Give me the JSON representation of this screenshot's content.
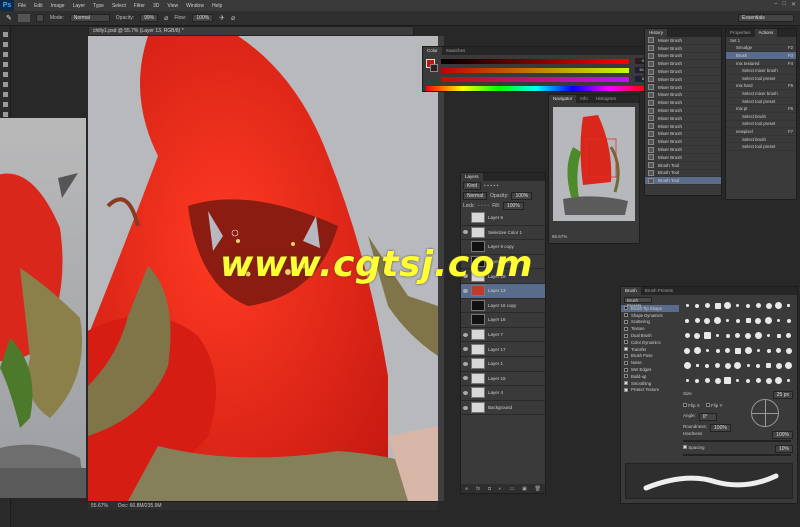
{
  "app": {
    "logo": "Ps",
    "menu": [
      "File",
      "Edit",
      "Image",
      "Layer",
      "Type",
      "Select",
      "Filter",
      "3D",
      "View",
      "Window",
      "Help"
    ]
  },
  "options_bar": {
    "mode_label": "Mode:",
    "mode_value": "Normal",
    "opacity_label": "Opacity:",
    "opacity_value": "99%",
    "flow_label": "Flow:",
    "flow_value": "100%",
    "workspace": "Essentials"
  },
  "document": {
    "tab_title": "chilly1.psd @ 55.7% (Layer 13, RGB/8) *",
    "zoom": "55.67%",
    "doc_size": "Doc: 66.8M/235.9M"
  },
  "watermark": "www.cgtsj.com",
  "color_panel": {
    "tabs": [
      "Color",
      "Swatches"
    ],
    "values": [
      "0",
      "51",
      "5"
    ]
  },
  "history_panel": {
    "tab": "History",
    "items": [
      "Mixer Brush",
      "Mixer Brush",
      "Mixer Brush",
      "Mixer Brush",
      "Mixer Brush",
      "Mixer Brush",
      "Mixer Brush",
      "Mixer Brush",
      "Mixer Brush",
      "Mixer Brush",
      "Mixer Brush",
      "Mixer Brush",
      "Mixer Brush",
      "Mixer Brush",
      "Mixer Brush",
      "Mixer Brush",
      "Brush Tool",
      "Brush Tool",
      "Brush Tool"
    ]
  },
  "actions_panel": {
    "tabs": [
      "Properties",
      "Actions"
    ],
    "items": [
      {
        "label": "Set 1",
        "key": ""
      },
      {
        "label": "Smudge",
        "key": "F2"
      },
      {
        "label": "Brush",
        "key": "F3"
      },
      {
        "label": "mix textured",
        "key": "F4"
      },
      {
        "label": "Select mixer brush",
        "key": ""
      },
      {
        "label": "Select tool preset",
        "key": ""
      },
      {
        "label": "mix hard",
        "key": "F5"
      },
      {
        "label": "Select mixer brush",
        "key": ""
      },
      {
        "label": "Select tool preset",
        "key": ""
      },
      {
        "label": "mix pt",
        "key": "F6"
      },
      {
        "label": "Select brush",
        "key": ""
      },
      {
        "label": "Select tool preset",
        "key": ""
      },
      {
        "label": "newpixel",
        "key": "F7"
      },
      {
        "label": "Select brush",
        "key": ""
      },
      {
        "label": "Select tool preset",
        "key": ""
      }
    ]
  },
  "navigator": {
    "tabs": [
      "Navigator",
      "Info",
      "Histogram"
    ],
    "zoom": "55.67%"
  },
  "layers_panel": {
    "tab": "Layers",
    "kind": "Kind",
    "blend": "Normal",
    "opacity_label": "Opacity:",
    "opacity": "100%",
    "fill_label": "Fill:",
    "fill": "100%",
    "lock_label": "Lock:",
    "layers": [
      {
        "name": "Layer 6",
        "visible": false,
        "selected": false
      },
      {
        "name": "Selective Color 1",
        "visible": true,
        "selected": false
      },
      {
        "name": "Layer 9 copy",
        "visible": false,
        "selected": false
      },
      {
        "name": "Layer 18 copy",
        "visible": false,
        "selected": false
      },
      {
        "name": "Layer 18",
        "visible": true,
        "selected": false
      },
      {
        "name": "Layer 13",
        "visible": true,
        "selected": true
      },
      {
        "name": "Layer 16 copy",
        "visible": false,
        "selected": false
      },
      {
        "name": "Layer 16",
        "visible": false,
        "selected": false
      },
      {
        "name": "Layer 7",
        "visible": true,
        "selected": false
      },
      {
        "name": "Layer 17",
        "visible": true,
        "selected": false
      },
      {
        "name": "Layer 1",
        "visible": true,
        "selected": false
      },
      {
        "name": "Layer 15",
        "visible": true,
        "selected": false
      },
      {
        "name": "Layer 4",
        "visible": true,
        "selected": false
      },
      {
        "name": "Background",
        "visible": true,
        "selected": false
      }
    ]
  },
  "brush_panel": {
    "tabs": [
      "Brush",
      "Brush Presets"
    ],
    "presets_button": "Brush Presets",
    "options": [
      {
        "label": "Brush Tip Shape",
        "checked": false
      },
      {
        "label": "Shape Dynamics",
        "checked": false
      },
      {
        "label": "Scattering",
        "checked": false
      },
      {
        "label": "Texture",
        "checked": false
      },
      {
        "label": "Dual Brush",
        "checked": false
      },
      {
        "label": "Color Dynamics",
        "checked": false
      },
      {
        "label": "Transfer",
        "checked": true
      },
      {
        "label": "Brush Pose",
        "checked": false
      },
      {
        "label": "Noise",
        "checked": false
      },
      {
        "label": "Wet Edges",
        "checked": false
      },
      {
        "label": "Build-up",
        "checked": false
      },
      {
        "label": "Smoothing",
        "checked": true
      },
      {
        "label": "Protect Texture",
        "checked": true
      }
    ],
    "size_label": "Size",
    "size_value": "25 px",
    "flip_x": "Flip X",
    "flip_y": "Flip Y",
    "angle_label": "Angle:",
    "angle_value": "0°",
    "roundness_label": "Roundness:",
    "roundness_value": "100%",
    "hardness_label": "Hardness",
    "hardness_value": "100%",
    "spacing_label": "Spacing",
    "spacing_value": "10%"
  }
}
